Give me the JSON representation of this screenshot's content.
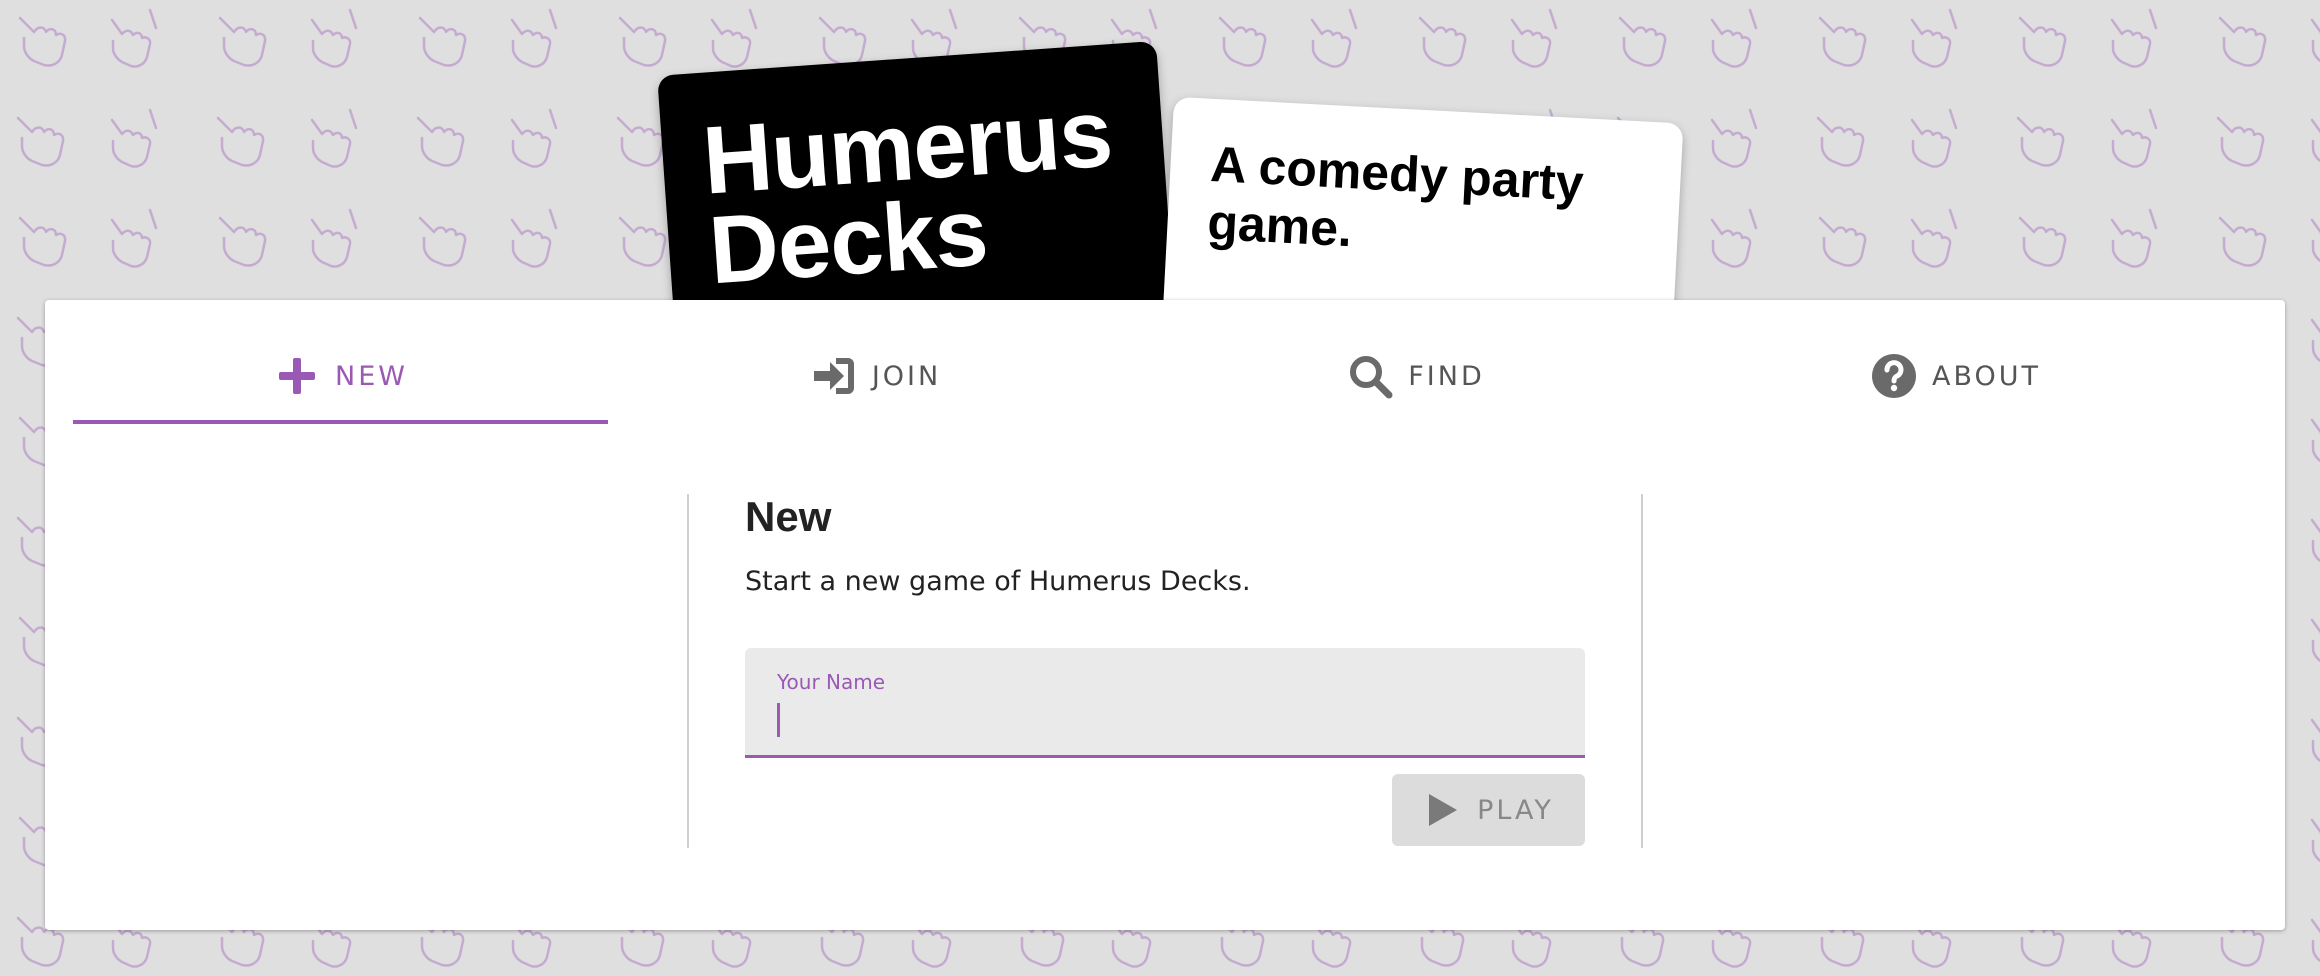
{
  "brand": {
    "title": "Humerus Decks",
    "tagline": "A comedy party game."
  },
  "tabs": [
    {
      "label": "NEW",
      "icon": "plus-icon",
      "active": true
    },
    {
      "label": "JOIN",
      "icon": "sign-in-icon",
      "active": false
    },
    {
      "label": "FIND",
      "icon": "search-icon",
      "active": false
    },
    {
      "label": "ABOUT",
      "icon": "question-circle-icon",
      "active": false
    }
  ],
  "new_game": {
    "heading": "New",
    "description": "Start a new game of Humerus Decks.",
    "name_field": {
      "label": "Your Name",
      "value": "",
      "placeholder": ""
    },
    "play_button": {
      "label": "PLAY",
      "icon": "play-icon",
      "disabled": true
    }
  },
  "colors": {
    "accent": "#9b59b6",
    "background": "#e0dfe0",
    "panel": "#ffffff",
    "tab_inactive": "#555555",
    "button_disabled_bg": "#dcdcdc"
  }
}
